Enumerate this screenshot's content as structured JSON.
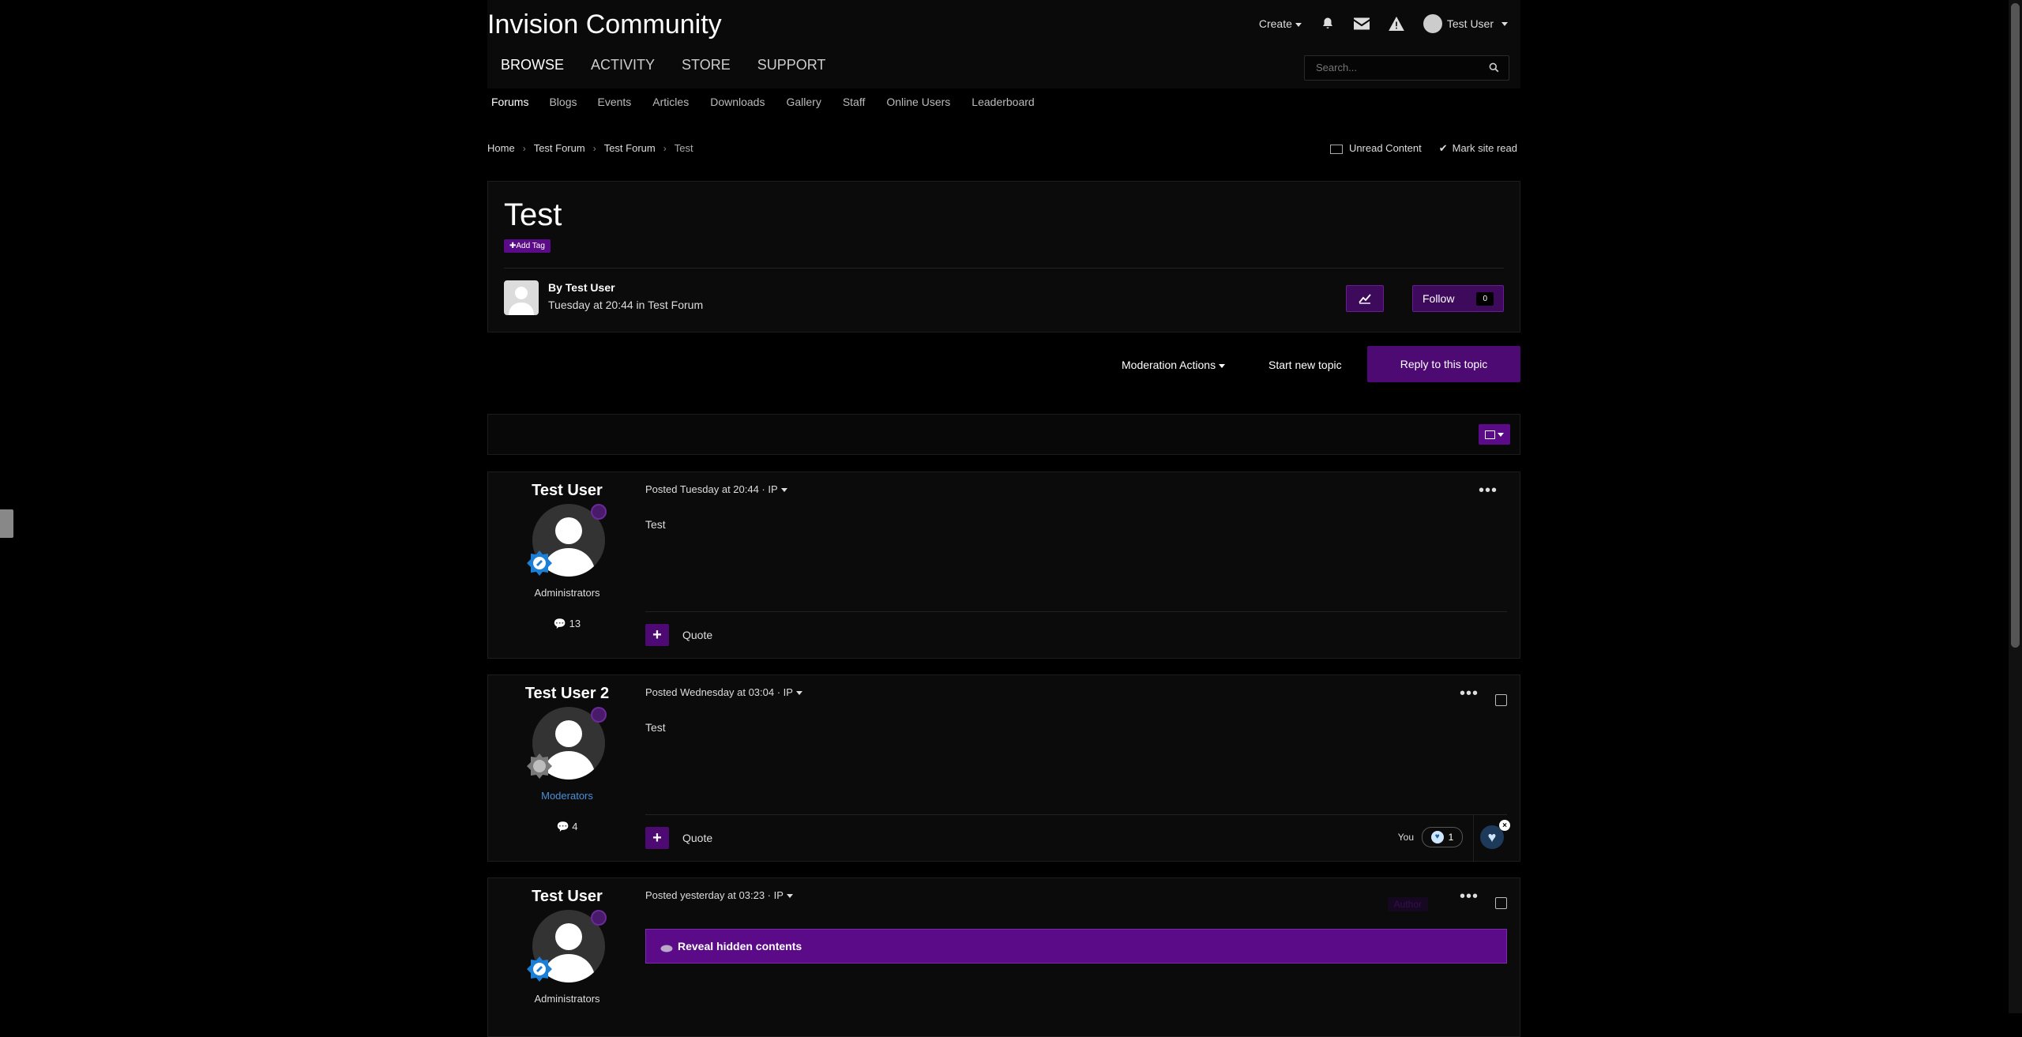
{
  "header": {
    "logo": "Invision Community",
    "create_label": "Create",
    "user_label": "Test User"
  },
  "primary_nav": [
    "BROWSE",
    "ACTIVITY",
    "STORE",
    "SUPPORT"
  ],
  "search": {
    "placeholder": "Search..."
  },
  "sub_nav": [
    "Forums",
    "Blogs",
    "Events",
    "Articles",
    "Downloads",
    "Gallery",
    "Staff",
    "Online Users",
    "Leaderboard"
  ],
  "breadcrumb": [
    "Home",
    "Test Forum",
    "Test Forum",
    "Test"
  ],
  "breadcrumb_actions": {
    "unread": "Unread Content",
    "mark_read": "Mark site read"
  },
  "topic": {
    "title": "Test",
    "add_tag": "Add Tag",
    "by_line": "By Test User",
    "date_line": "Tuesday at 20:44 in Test Forum",
    "follow_label": "Follow",
    "follow_count": "0"
  },
  "actions": {
    "moderation": "Moderation Actions",
    "new_topic": "Start new topic",
    "reply": "Reply to this topic"
  },
  "posts": [
    {
      "author": "Test User",
      "group": "Administrators",
      "count": "13",
      "meta": "Posted Tuesday at 20:44 · IP",
      "body": "Test",
      "quote": "Quote"
    },
    {
      "author": "Test User 2",
      "group": "Moderators",
      "count": "4",
      "meta": "Posted Wednesday at 03:04 · IP",
      "body": "Test",
      "quote": "Quote",
      "reaction_you": "You",
      "reaction_count": "1"
    },
    {
      "author": "Test User",
      "group": "Administrators",
      "meta": "Posted yesterday at 03:23 · IP",
      "author_badge": "Author",
      "reveal": "Reveal hidden contents"
    }
  ],
  "colors": {
    "accent": "#5b0b87",
    "background": "#000000",
    "panel": "#0b0b0b",
    "moderator": "#4a8fd8"
  }
}
